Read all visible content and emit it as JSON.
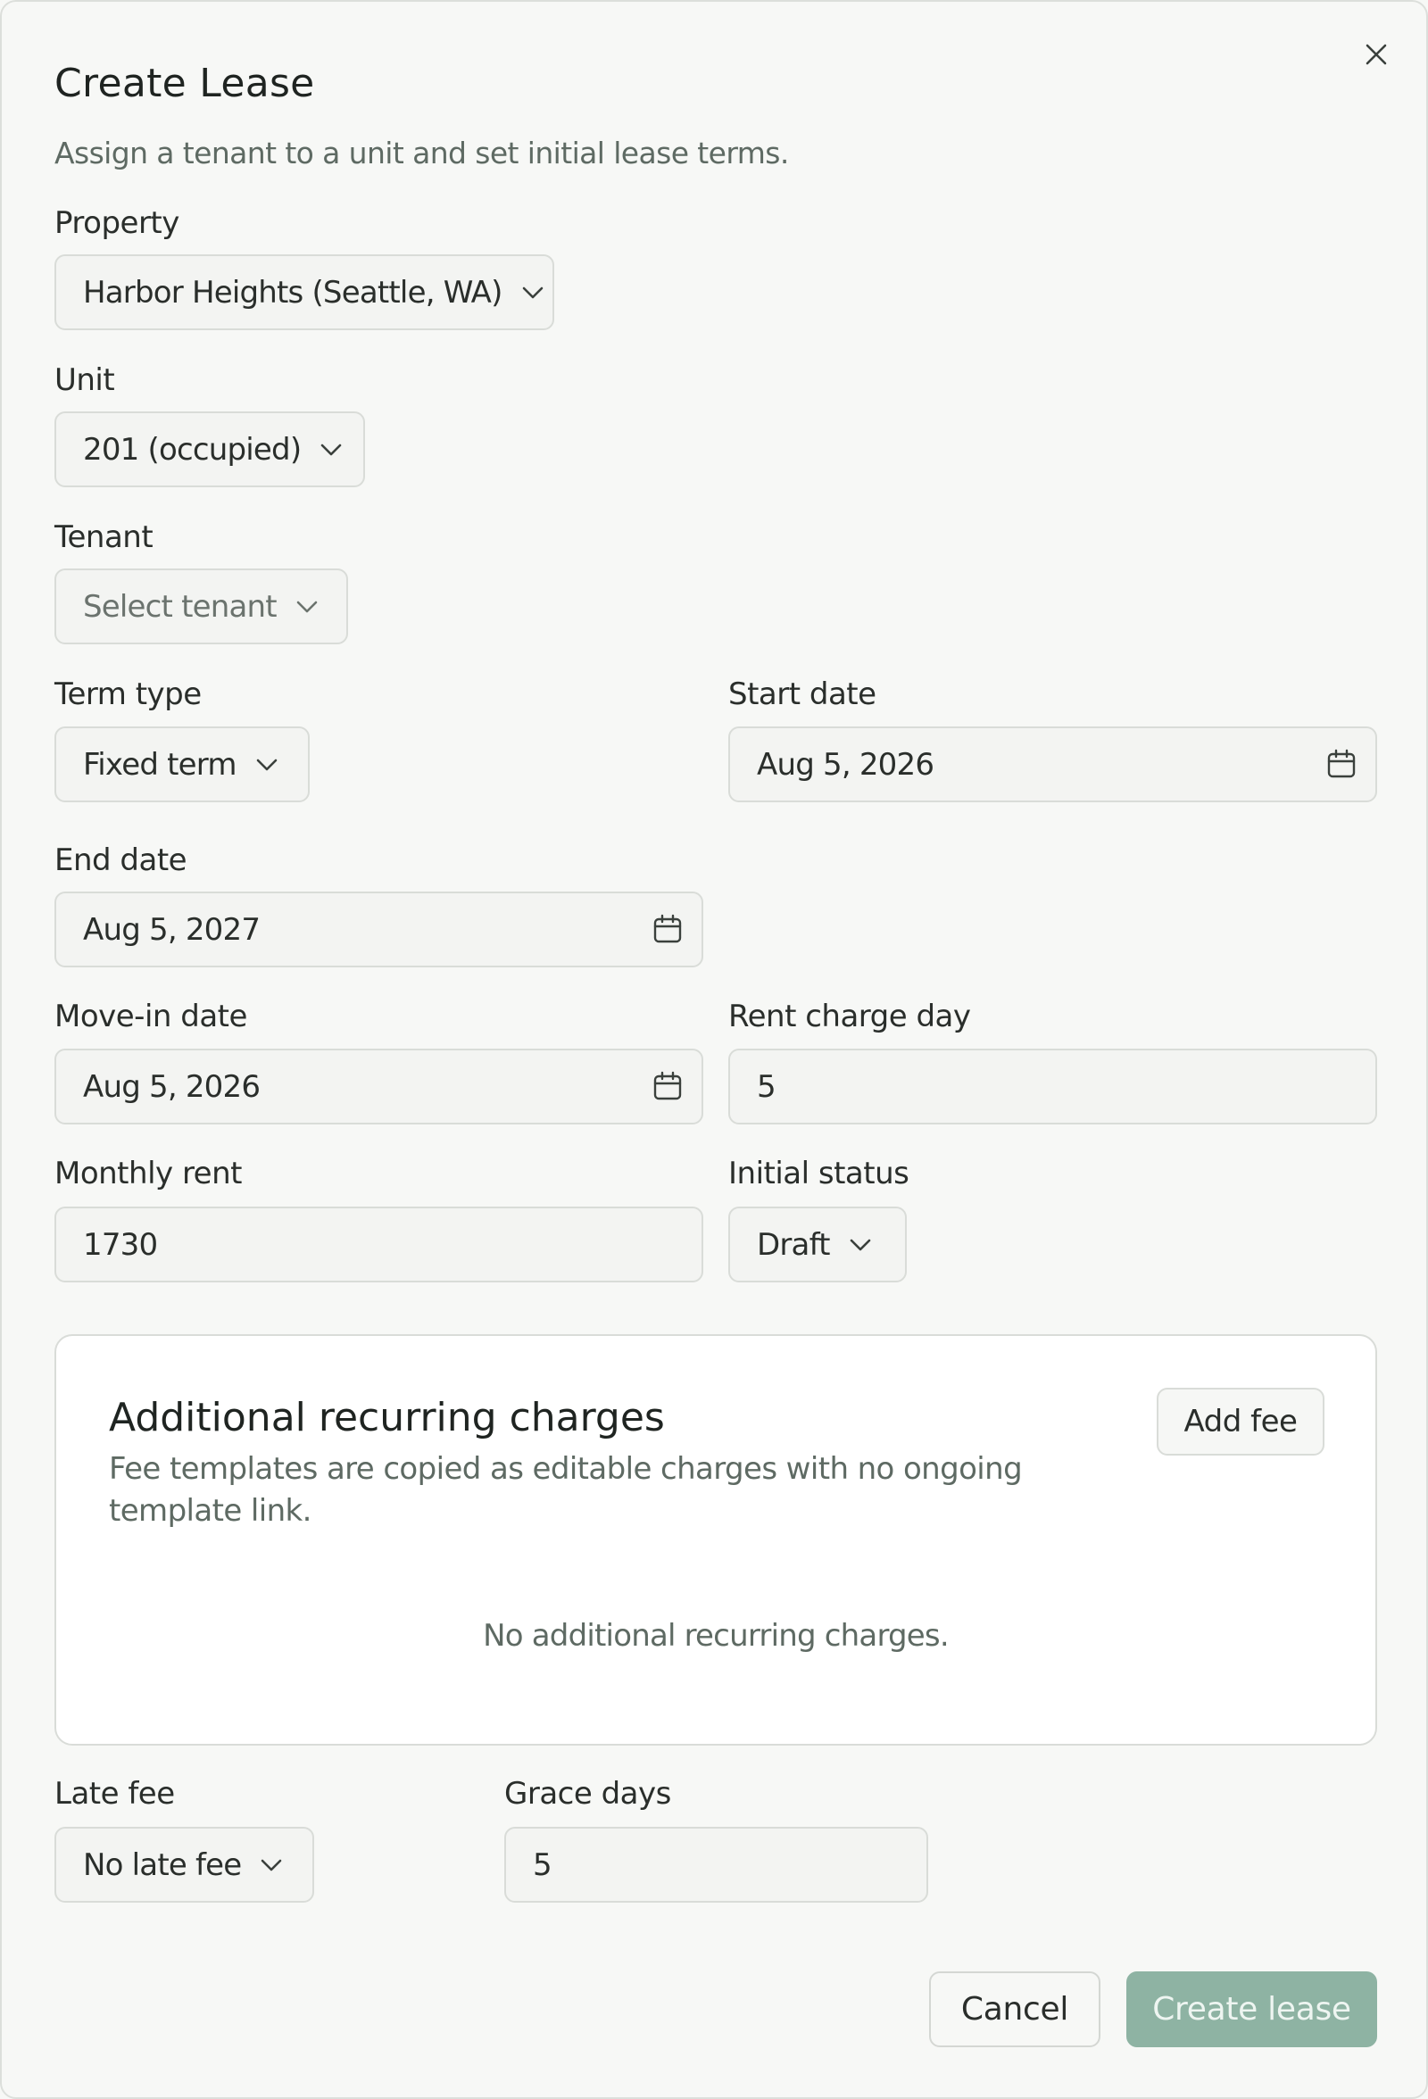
{
  "dialog": {
    "title": "Create Lease",
    "subtitle": "Assign a tenant to a unit and set initial lease terms.",
    "close_icon": "close-icon"
  },
  "fields": {
    "property": {
      "label": "Property",
      "value": "Harbor Heights (Seattle, WA)"
    },
    "unit": {
      "label": "Unit",
      "value": "201 (occupied)"
    },
    "tenant": {
      "label": "Tenant",
      "placeholder": "Select tenant"
    },
    "term_type": {
      "label": "Term type",
      "value": "Fixed term"
    },
    "start_date": {
      "label": "Start date",
      "value": "Aug 5, 2026"
    },
    "end_date": {
      "label": "End date",
      "value": "Aug 5, 2027"
    },
    "move_in_date": {
      "label": "Move-in date",
      "value": "Aug 5, 2026"
    },
    "rent_charge_day": {
      "label": "Rent charge day",
      "value": "5"
    },
    "monthly_rent": {
      "label": "Monthly rent",
      "value": "1730"
    },
    "initial_status": {
      "label": "Initial status",
      "value": "Draft"
    },
    "late_fee": {
      "label": "Late fee",
      "value": "No late fee"
    },
    "grace_days": {
      "label": "Grace days",
      "value": "5"
    }
  },
  "recurring_charges": {
    "title": "Additional recurring charges",
    "description": "Fee templates are copied as editable charges with no ongoing template link.",
    "add_label": "Add fee",
    "empty_text": "No additional recurring charges."
  },
  "footer": {
    "cancel_label": "Cancel",
    "create_label": "Create lease"
  },
  "colors": {
    "background": "#f7f8f6",
    "primary_disabled": "#8eb3a3",
    "border": "#d9dcd8",
    "muted_text": "#5e6a63"
  }
}
